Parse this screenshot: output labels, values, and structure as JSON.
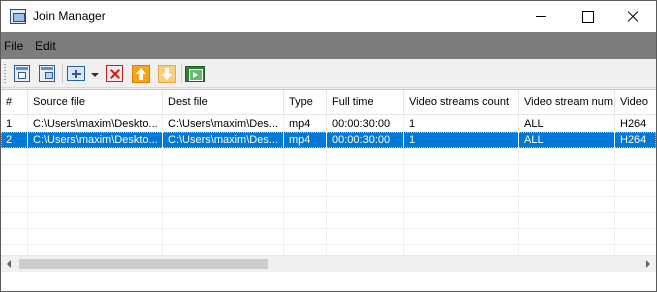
{
  "window": {
    "title": "Join Manager"
  },
  "menu": {
    "items": [
      {
        "label": "File"
      },
      {
        "label": "Edit"
      }
    ]
  },
  "toolbar": {
    "buttons": [
      {
        "icon": "add-file-icon"
      },
      {
        "icon": "add-files-icon"
      },
      {
        "icon": "add-dropdown-icon"
      },
      {
        "icon": "remove-icon"
      },
      {
        "icon": "move-up-icon"
      },
      {
        "icon": "move-down-icon"
      },
      {
        "icon": "join-video-icon"
      }
    ]
  },
  "table": {
    "columns": [
      "#",
      "Source file",
      "Dest file",
      "Type",
      "Full time",
      "Video streams count",
      "Video stream num",
      "Video"
    ],
    "rows": [
      {
        "cells": [
          "1",
          "C:\\Users\\maxim\\Deskto...",
          "C:\\Users\\maxim\\Des...",
          "mp4",
          "00:00:30:00",
          "1",
          "ALL",
          "H264"
        ],
        "selected": false
      },
      {
        "cells": [
          "2",
          "C:\\Users\\maxim\\Deskto...",
          "C:\\Users\\maxim\\Des...",
          "mp4",
          "00:00:30:00",
          "1",
          "ALL",
          "H264"
        ],
        "selected": true
      }
    ]
  },
  "colors": {
    "selection": "#0078d7",
    "menubar": "#7d7d7d"
  }
}
